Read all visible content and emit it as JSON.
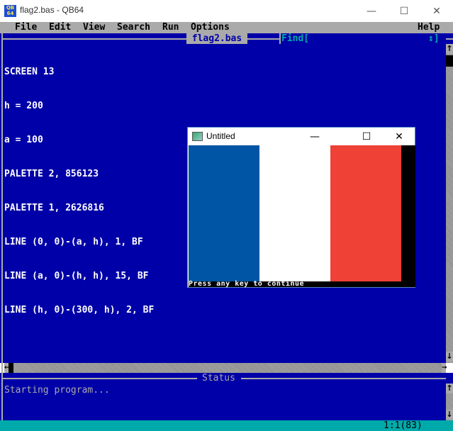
{
  "window": {
    "title": "flag2.bas - QB64",
    "icon": "qb64-icon",
    "icon_text": "QB 64",
    "controls": {
      "minimize": "—",
      "maximize": "☐",
      "close": "✕"
    }
  },
  "menu": {
    "items": [
      "File",
      "Edit",
      "View",
      "Search",
      "Run",
      "Options"
    ],
    "help": "Help"
  },
  "editor": {
    "tab_title": "flag2.bas",
    "find_label": "Find[",
    "find_arrows": "↕]",
    "code_lines": [
      "SCREEN 13",
      "h = 200",
      "a = 100",
      "PALETTE 2, 856123",
      "PALETTE 1, 2626816",
      "LINE (0, 0)-(a, h), 1, BF",
      "LINE (a, 0)-(h, h), 15, BF",
      "LINE (h, 0)-(300, h), 2, BF"
    ],
    "scroll": {
      "up": "↑",
      "down": "↓",
      "left": "←",
      "right": "→"
    }
  },
  "status": {
    "title": "Status",
    "message": "Starting program..."
  },
  "bottom_bar": {
    "cursor_position": "1:1(83)"
  },
  "output_window": {
    "title": "Untitled",
    "controls": {
      "minimize": "—",
      "maximize": "☐",
      "close": "✕"
    },
    "prompt": "Press any key to continue",
    "colors": {
      "blue": "#0055a4",
      "white": "#ffffff",
      "red": "#ef4135",
      "background": "#000000"
    }
  },
  "colors": {
    "editor_bg": "#0000a8",
    "menu_bg": "#aaaaaa",
    "status_bar_bg": "#00aaaa",
    "find_text": "#00aaaa"
  }
}
